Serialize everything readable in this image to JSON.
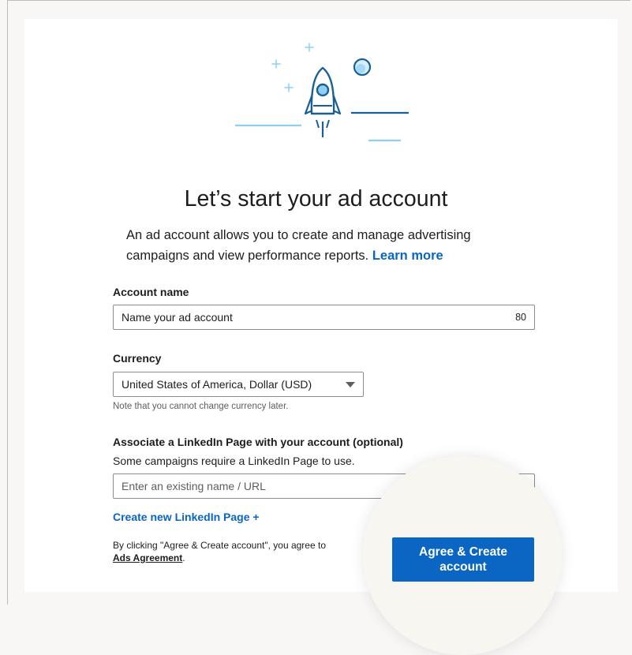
{
  "header": {
    "title": "Let’s start your ad account",
    "intro_text": "An ad account allows you to create and manage advertising campaigns and view performance reports.",
    "learn_more": "Learn more"
  },
  "account_name": {
    "label": "Account name",
    "placeholder": "Name your ad account",
    "char_limit": "80"
  },
  "currency": {
    "label": "Currency",
    "selected": "United States of America, Dollar (USD)",
    "note": "Note that you cannot change currency later."
  },
  "linkedin_page": {
    "label": "Associate a LinkedIn Page with your account (optional)",
    "subtext": "Some campaigns require a LinkedIn Page to use.",
    "placeholder": "Enter an existing name / URL",
    "create_link": "Create new LinkedIn Page +"
  },
  "legal": {
    "text": "By clicking \"Agree & Create account\", you agree to",
    "agreement_link": "Ads Agreement",
    "suffix": "."
  },
  "cta": {
    "label": "Agree & Create account"
  },
  "icons": {
    "hero": "rocket-launch-illustration",
    "dropdown": "chevron-down-icon"
  },
  "colors": {
    "accent": "#0a66c2",
    "illustration_dark": "#1a5f94",
    "illustration_light": "#8fd0f2"
  }
}
